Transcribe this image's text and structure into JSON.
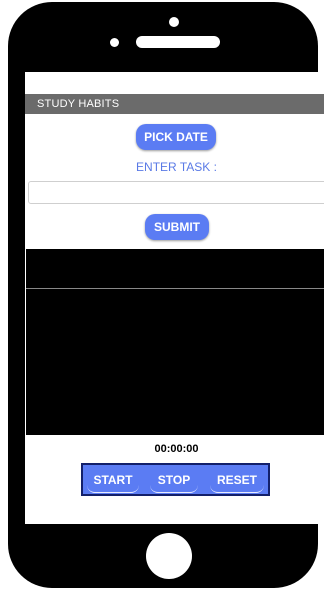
{
  "app": {
    "title": "STUDY HABITS"
  },
  "form": {
    "pick_date_label": "PICK DATE",
    "enter_task_label": "ENTER TASK :",
    "task_value": "",
    "submit_label": "SUBMIT"
  },
  "timer": {
    "display": "00:00:00"
  },
  "controls": {
    "start_label": "START",
    "stop_label": "STOP",
    "reset_label": "RESET"
  },
  "colors": {
    "accent": "#5b7cf3",
    "label": "#5a7ae6",
    "titlebar": "#6b6b6b",
    "control_border": "#13206b"
  }
}
